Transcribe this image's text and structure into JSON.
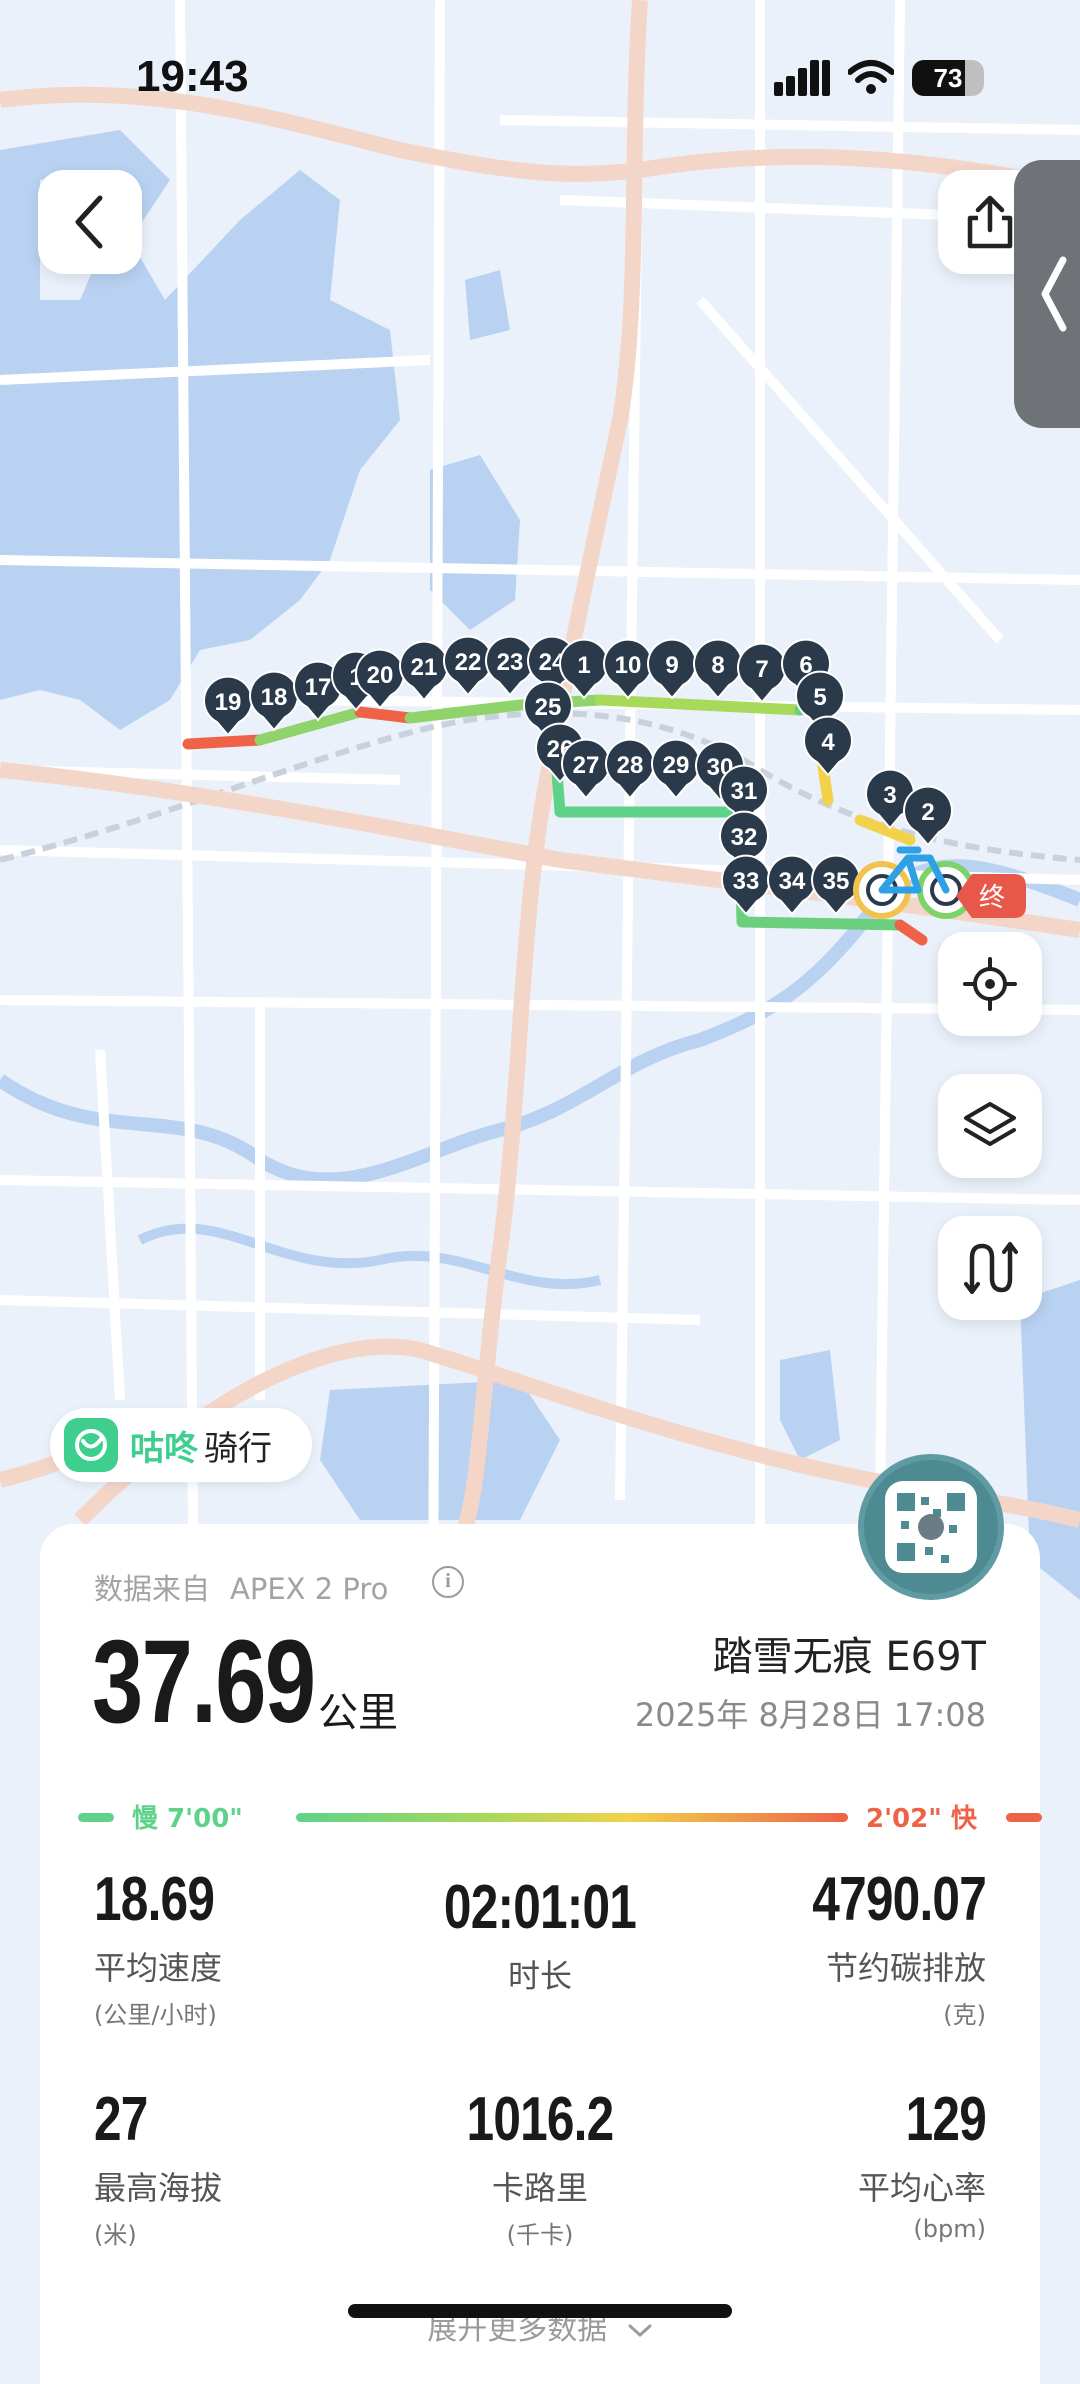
{
  "status_bar": {
    "time": "19:43",
    "battery_level": "73"
  },
  "map": {
    "markers": [
      "19",
      "18",
      "17",
      "1",
      "20",
      "21",
      "22",
      "23",
      "24",
      "1",
      "10",
      "9",
      "8",
      "7",
      "6",
      "5",
      "4",
      "25",
      "26",
      "27",
      "28",
      "29",
      "30",
      "31",
      "32",
      "33",
      "34",
      "35",
      "3",
      "2"
    ],
    "end_label": "终",
    "colors": {
      "water": "#b9d2f1",
      "land": "#eaf1fb",
      "road_major": "#f4d6c9",
      "road_minor": "#ffffff",
      "marker": "#2b3a4a",
      "end": "#e8584a"
    }
  },
  "buttons": {
    "back_icon": "chevron-left-icon",
    "share_icon": "share-icon",
    "side_icon": "chevron-left-icon",
    "locate_icon": "crosshair-icon",
    "layers_icon": "layers-icon",
    "altitude_icon": "route-curve-icon"
  },
  "brand": {
    "name": "咕咚",
    "suffix": "骑行"
  },
  "summary": {
    "source_label": "数据来自",
    "device": "APEX 2 Pro",
    "distance": "37.69",
    "distance_unit": "公里",
    "bike": "踏雪无痕 E69T",
    "date": "2025年 8月28日 17:08"
  },
  "pace": {
    "slow_label": "慢 7'00\"",
    "fast_label": "2'02\" 快",
    "slow_color": "#5fd28a",
    "fast_color": "#ee6248"
  },
  "stats": [
    {
      "value": "18.69",
      "label": "平均速度",
      "unit": "(公里/小时)"
    },
    {
      "value": "02:01:01",
      "label": "时长",
      "unit": ""
    },
    {
      "value": "4790.07",
      "label": "节约碳排放",
      "unit": "(克)"
    },
    {
      "value": "27",
      "label": "最高海拔",
      "unit": "(米)"
    },
    {
      "value": "1016.2",
      "label": "卡路里",
      "unit": "(千卡)"
    },
    {
      "value": "129",
      "label": "平均心率",
      "unit": "(bpm)"
    }
  ],
  "more_label": "展开更多数据"
}
